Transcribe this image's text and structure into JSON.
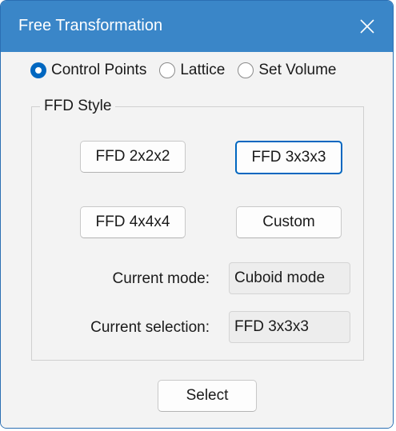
{
  "window": {
    "title": "Free Transformation",
    "close_icon": "close-icon"
  },
  "mode_options": [
    {
      "label": "Control Points",
      "checked": true
    },
    {
      "label": "Lattice",
      "checked": false
    },
    {
      "label": "Set Volume",
      "checked": false
    }
  ],
  "ffd_style": {
    "group_label": "FFD Style",
    "buttons": {
      "ffd2": "FFD 2x2x2",
      "ffd3": "FFD 3x3x3",
      "ffd4": "FFD 4x4x4",
      "custom": "Custom"
    },
    "current_mode_label": "Current mode:",
    "current_mode_value": "Cuboid mode",
    "current_selection_label": "Current selection:",
    "current_selection_value": "FFD 3x3x3"
  },
  "footer": {
    "select_label": "Select"
  },
  "colors": {
    "titlebar": "#3a86c8",
    "accent": "#0067c0",
    "background": "#f3f3f3"
  }
}
